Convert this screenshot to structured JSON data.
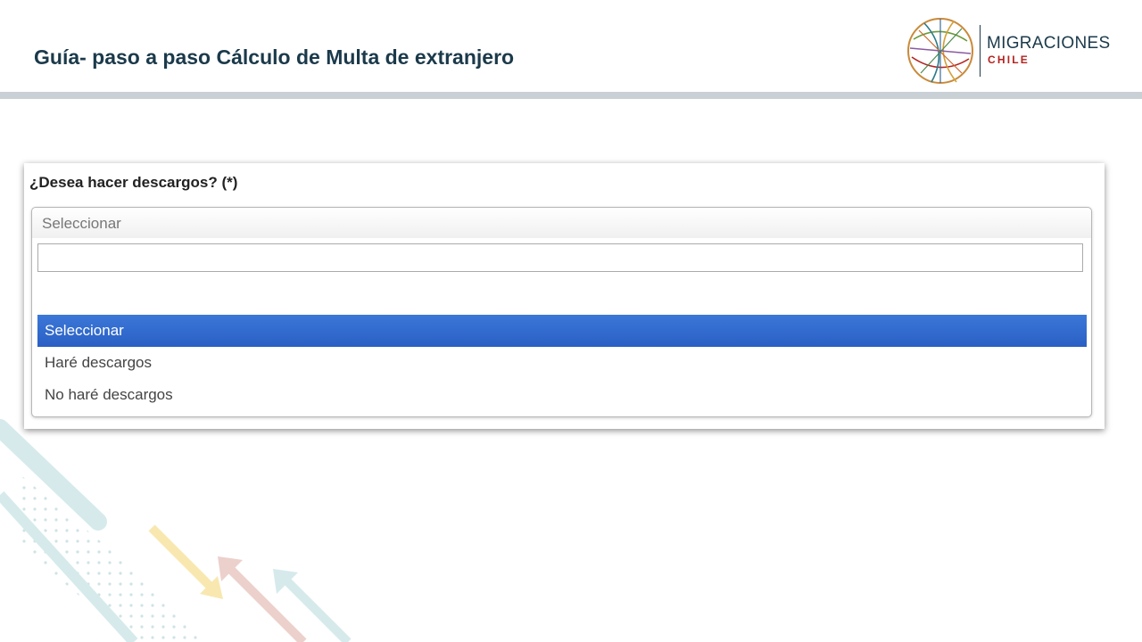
{
  "slide": {
    "title": "Guía- paso a paso Cálculo de Multa de extranjero"
  },
  "logo": {
    "name": "MIGRACIONES",
    "sub": "CHILE"
  },
  "form": {
    "label": "¿Desea hacer descargos? (*)",
    "select": {
      "selected": "Seleccionar",
      "search_value": "",
      "options": [
        "Seleccionar",
        "Haré descargos",
        "No haré descargos"
      ],
      "highlighted_index": 0
    }
  },
  "colors": {
    "title": "#1b3a4b",
    "highlight": "#2f6bd0",
    "logo_red": "#b3231f"
  }
}
